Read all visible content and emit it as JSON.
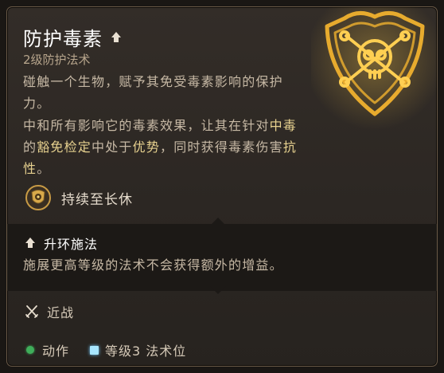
{
  "spell": {
    "name": "防护毒素",
    "level_school": "2级防护法术",
    "description_1": "碰触一个生物，赋予其免受毒素影响的保护力。",
    "description_2": {
      "a": "中和所有影响它的毒素效果，让其在针对",
      "b": "中毒",
      "c": "的",
      "d": "豁免检定",
      "e": "中处于",
      "f": "优势",
      "g": "，同时获得毒素伤害",
      "h": "抗性",
      "i": "。"
    },
    "duration": "持续至长休",
    "upcast_title": "升环施法",
    "upcast_description": "施展更高等级的法术不会获得额外的增益。",
    "range": "近战",
    "cost_action": "动作",
    "cost_slot": "等级3 法术位"
  },
  "icons": {
    "emblem": "poison-skull-shield-icon",
    "upcast": "upcast-arrow-icon",
    "duration": "long-rest-icon",
    "melee": "crossed-swords-icon",
    "action": "green-action-dot-icon",
    "slot": "spell-slot-icon"
  },
  "colors": {
    "highlight": "#e7d18f",
    "emblem_glow": "#f2b230",
    "action": "#3fae5a",
    "slot": "#a8e6ff"
  }
}
